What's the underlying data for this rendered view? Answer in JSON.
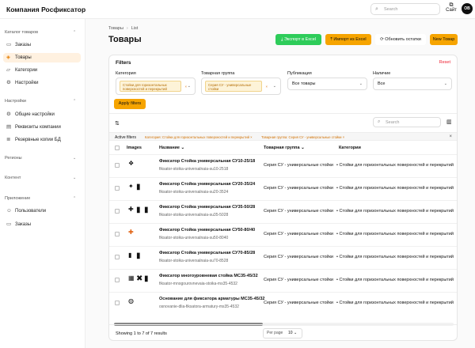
{
  "app": {
    "brand": "Компания Росфиксатор",
    "search_placeholder": "Search",
    "site_label": "Сайт",
    "avatar": "OB"
  },
  "sidebar": {
    "sections": [
      {
        "label": "Каталог товаров",
        "items": [
          {
            "label": "Заказы",
            "icon": "orders-icon"
          },
          {
            "label": "Товары",
            "icon": "cube-icon",
            "active": true
          },
          {
            "label": "Категории",
            "icon": "folder-icon"
          },
          {
            "label": "Настройки",
            "icon": "gear-icon"
          }
        ]
      },
      {
        "label": "Настройки",
        "items": [
          {
            "label": "Общие настройки",
            "icon": "gear-icon"
          },
          {
            "label": "Реквизиты компании",
            "icon": "building-icon"
          },
          {
            "label": "Резервные копии БД",
            "icon": "database-icon"
          }
        ]
      },
      {
        "label": "Регионы",
        "items": []
      },
      {
        "label": "Контент",
        "items": []
      },
      {
        "label": "Приложение",
        "items": [
          {
            "label": "Пользователи",
            "icon": "users-icon"
          },
          {
            "label": "Заказы",
            "icon": "orders-icon"
          }
        ]
      }
    ]
  },
  "page": {
    "breadcrumb": [
      "Товары",
      "List"
    ],
    "title": "Товары",
    "buttons": {
      "export": "Экспорт в Excel",
      "import": "Импорт из Excel",
      "refresh": "Обновить остатки",
      "new": "New Товар"
    }
  },
  "filters": {
    "title": "Filters",
    "reset": "Reset",
    "category_label": "Категория",
    "category_tag": "Стойки для горизонтальных поверхностей и перекрытий",
    "group_label": "Товарная группа",
    "group_tag": "Серия СУ - универсальные стойки",
    "publication_label": "Публикация",
    "publication_value": "Все товары",
    "stock_label": "Наличие",
    "stock_value": "Все",
    "apply": "Apply filters"
  },
  "toolbar": {
    "search_placeholder": "Search"
  },
  "active_filters": {
    "label": "Active filters",
    "chips": [
      "Категория: Стойки для горизонтальных поверхностей и перекрытий",
      "Товарная группа: Серия СУ - универсальные стойки"
    ]
  },
  "table": {
    "columns": [
      "Images",
      "Название",
      "Товарная группа",
      "Категории"
    ],
    "rows": [
      {
        "name": "Фиксатор Стойка универсальная СУ10-25/18",
        "sku": "fiksator-stoika-universalnaia-su10-2518",
        "group": "Серия СУ - универсальные стойки",
        "category": "Стойки для горизонтальных поверхностей и перекрытий"
      },
      {
        "name": "Фиксатор Стойка универсальная СУ20-35/24",
        "sku": "fiksator-stoika-universalnaia-su20-3524",
        "group": "Серия СУ - универсальные стойки",
        "category": "Стойки для горизонтальных поверхностей и перекрытий"
      },
      {
        "name": "Фиксатор Стойка универсальная СУ35-50/28",
        "sku": "fiksator-stoika-universalnaia-su35-5028",
        "group": "Серия СУ - универсальные стойки",
        "category": "Стойки для горизонтальных поверхностей и перекрытий"
      },
      {
        "name": "Фиксатор Стойка универсальная СУ50-80/40",
        "sku": "fiksator-stoika-universalnaia-su50-8040",
        "group": "Серия СУ - универсальные стойки",
        "category": "Стойки для горизонтальных поверхностей и перекрытий"
      },
      {
        "name": "Фиксатор Стойка универсальная СУ70-85/28",
        "sku": "fiksator-stoika-universalnaia-su70-8528",
        "group": "Серия СУ - универсальные стойки",
        "category": "Стойки для горизонтальных поверхностей и перекрытий"
      },
      {
        "name": "Фиксатор многоуровневая стойка МС35-45/32",
        "sku": "fiksator-mnogourovnevaia-stoika-ms35-4532",
        "group": "Серия СУ - универсальные стойки",
        "category": "Стойки для горизонтальных поверхностей и перекрытий"
      },
      {
        "name": "Основание для фиксатора арматуры МС35-45/32",
        "sku": "osnovanie-dlia-fiksatora-armatury-ms35-4532",
        "group": "Серия СУ - универсальные стойки",
        "category": "Стойки для горизонтальных поверхностей и перекрытий"
      }
    ]
  },
  "footer": {
    "summary": "Showing 1 to 7 of 7 results",
    "per_page_label": "Per page",
    "per_page_value": "10"
  },
  "colors": {
    "accent": "#f6a400",
    "export_green": "#2ecc5a",
    "reset_red": "#e22233"
  }
}
